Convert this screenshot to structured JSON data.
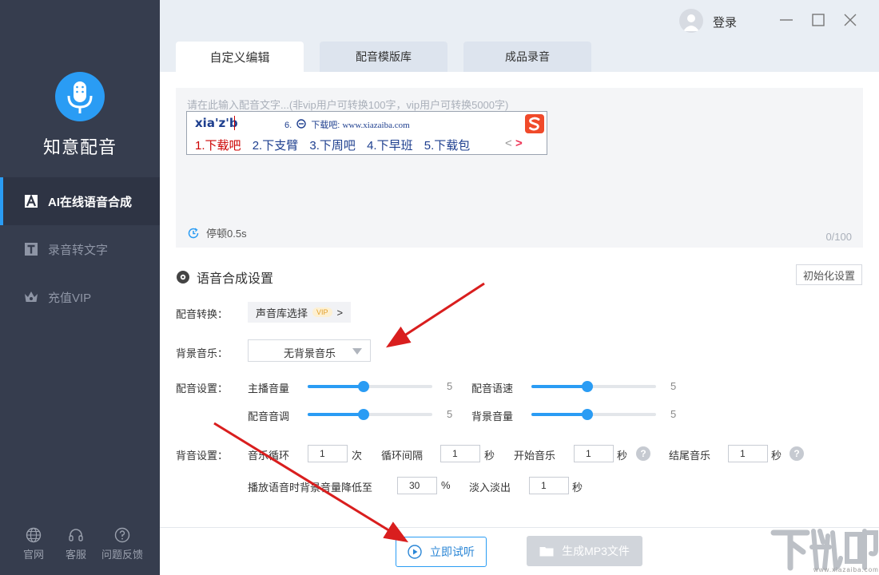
{
  "app": {
    "name": "知意配音"
  },
  "sidebar": {
    "items": [
      {
        "label": "AI在线语音合成",
        "icon": "a-letter-icon",
        "active": true
      },
      {
        "label": "录音转文字",
        "icon": "t-letter-icon",
        "active": false
      },
      {
        "label": "充值VIP",
        "icon": "crown-icon",
        "active": false
      }
    ],
    "footer": [
      {
        "label": "官网",
        "icon": "globe-icon"
      },
      {
        "label": "客服",
        "icon": "headset-icon"
      },
      {
        "label": "问题反馈",
        "icon": "question-circle-icon"
      }
    ]
  },
  "header": {
    "login_label": "登录",
    "window_controls": [
      "minimize-icon",
      "maximize-icon",
      "close-icon"
    ]
  },
  "tabs": [
    {
      "label": "自定义编辑",
      "active": true
    },
    {
      "label": "配音模版库",
      "active": false
    },
    {
      "label": "成品录音",
      "active": false
    }
  ],
  "editor": {
    "placeholder": "请在此输入配音文字...(非vip用户可转换100字，vip用户可转换5000字)",
    "pause_label": "停顿0.5s",
    "counter": "0/100"
  },
  "ime": {
    "composition": "xia'z'b",
    "sixth_candidate_prefix": "6.",
    "sixth_candidate_text": "下载吧:",
    "sixth_candidate_domain": "www.xiazaiba.com",
    "candidates": [
      "1.下载吧",
      "2.下支臂",
      "3.下周吧",
      "4.下早班",
      "5.下载包"
    ],
    "arrows": [
      "<",
      ">"
    ]
  },
  "settings": {
    "title": "语音合成设置",
    "reset_label": "初始化设置",
    "voice_label": "配音转换：",
    "voice_select": "声音库选择",
    "vip_badge": "VIP",
    "voice_chevron": ">",
    "bgm_label": "背景音乐：",
    "bgm_value": "无背景音乐",
    "dub_label": "配音设置：",
    "sliders": [
      {
        "label": "主播音量",
        "value": "5",
        "fraction": 0.45
      },
      {
        "label": "配音语速",
        "value": "5",
        "fraction": 0.45
      },
      {
        "label": "配音音调",
        "value": "5",
        "fraction": 0.45
      },
      {
        "label": "背景音量",
        "value": "5",
        "fraction": 0.45
      }
    ],
    "bg_label": "背音设置：",
    "loop_label": "音乐循环",
    "loop_value": "1",
    "loop_unit": "次",
    "interval_label": "循环间隔",
    "interval_value": "1",
    "interval_unit": "秒",
    "start_label": "开始音乐",
    "start_value": "1",
    "start_unit": "秒",
    "end_label": "结尾音乐",
    "end_value": "1",
    "end_unit": "秒",
    "duck_label": "播放语音时背景音量降低至",
    "duck_value": "30",
    "duck_unit": "%",
    "fade_label": "淡入淡出",
    "fade_value": "1",
    "fade_unit": "秒",
    "help_glyph": "?"
  },
  "actions": {
    "play_label": "立即试听",
    "mp3_label": "生成MP3文件"
  },
  "watermark": {
    "text": "下载吧",
    "url": "www.xiazaiba.com"
  },
  "colors": {
    "sidebar_bg": "#363d4e",
    "accent": "#2a9cf4",
    "annotation_arrow": "#d91e1e"
  }
}
